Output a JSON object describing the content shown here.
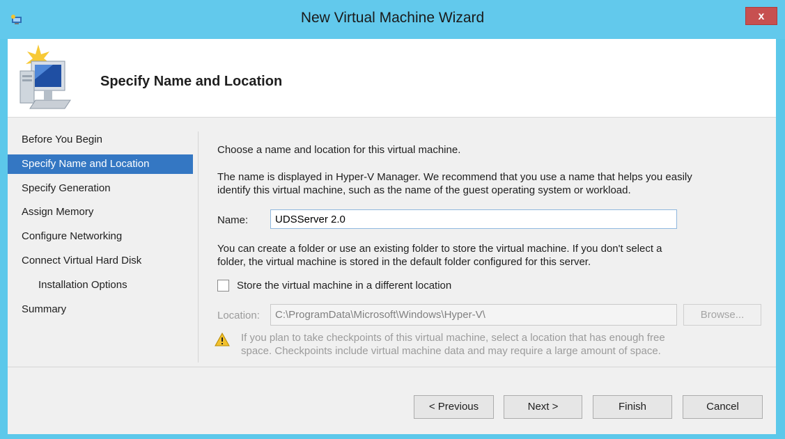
{
  "window": {
    "title": "New Virtual Machine Wizard",
    "close_label": "x"
  },
  "header": {
    "title": "Specify Name and Location"
  },
  "nav": {
    "items": [
      {
        "label": "Before You Begin"
      },
      {
        "label": "Specify Name and Location",
        "selected": true
      },
      {
        "label": "Specify Generation"
      },
      {
        "label": "Assign Memory"
      },
      {
        "label": "Configure Networking"
      },
      {
        "label": "Connect Virtual Hard Disk"
      },
      {
        "label": "Installation Options",
        "indented": true
      },
      {
        "label": "Summary"
      }
    ]
  },
  "main": {
    "intro": "Choose a name and location for this virtual machine.",
    "description_line1": "The name is displayed in Hyper-V Manager. We recommend that you use a name that helps you easily",
    "description_line2": "identify this virtual machine, such as the name of the guest operating system or workload.",
    "name_label": "Name:",
    "name_value": "UDSServer 2.0",
    "folder_line1": "You can create a folder or use an existing folder to store the virtual machine. If you don't select a",
    "folder_line2": "folder, the virtual machine is stored in the default folder configured for this server.",
    "store_checkbox_label": "Store the virtual machine in a different location",
    "store_checked": false,
    "location_label": "Location:",
    "location_value": "C:\\ProgramData\\Microsoft\\Windows\\Hyper-V\\",
    "browse_label": "Browse...",
    "warning_line1": "If you plan to take checkpoints of this virtual machine, select a location that has enough free",
    "warning_line2": "space. Checkpoints include virtual machine data and may require a large amount of space."
  },
  "footer": {
    "previous_label": "< Previous",
    "next_label": "Next >",
    "finish_label": "Finish",
    "cancel_label": "Cancel"
  },
  "colors": {
    "titlebar": "#62c9ec",
    "selection": "#3477c3",
    "close": "#c75050"
  },
  "icons": [
    "app-icon",
    "wizard-computer-icon",
    "warning-icon",
    "close-icon"
  ]
}
